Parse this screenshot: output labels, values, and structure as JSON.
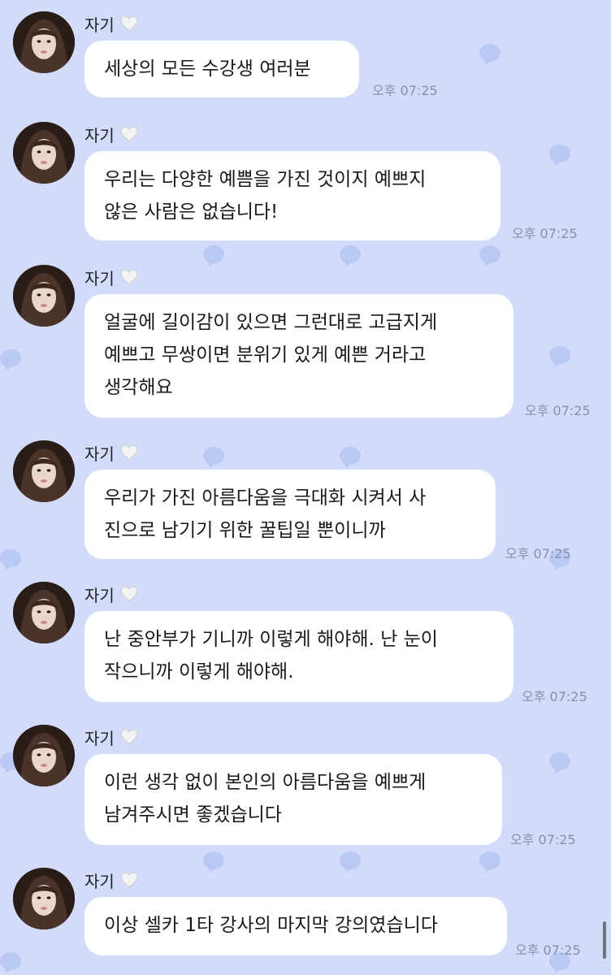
{
  "chat": {
    "sender_name": "자기",
    "sender_badge_icon": "white-heart-icon",
    "messages": [
      {
        "lines": [
          "세상의 모든 수강생 여러분"
        ],
        "time": "오후 07:25"
      },
      {
        "lines": [
          "우리는 다양한 예쁨을 가진 것이지 예쁘지",
          "않은 사람은 없습니다!"
        ],
        "time": "오후 07:25"
      },
      {
        "lines": [
          "얼굴에 길이감이 있으면 그런대로 고급지게",
          "예쁘고 무쌍이면 분위기 있게 예쁜 거라고",
          "생각해요"
        ],
        "time": "오후 07:25"
      },
      {
        "lines": [
          "우리가 가진 아름다움을 극대화 시켜서 사",
          "진으로 남기기 위한 꿀팁일 뿐이니까"
        ],
        "time": "오후 07:25"
      },
      {
        "lines": [
          "난 중안부가 기니까 이렇게 해야해. 난 눈이",
          "작으니까 이렇게 해야해."
        ],
        "time": "오후 07:25"
      },
      {
        "lines": [
          "이런 생각 없이 본인의 아름다움을 예쁘게",
          "남겨주시면 좋겠습니다"
        ],
        "time": "오후 07:25"
      },
      {
        "lines": [
          "이상 셀카 1타 강사의 마지막 강의였습니다"
        ],
        "time": "오후 07:25"
      }
    ]
  },
  "colors": {
    "background": "#d2dcfa",
    "bubble": "#ffffff",
    "time_text": "#8a8fa3",
    "pattern": "#b9c9f3"
  }
}
